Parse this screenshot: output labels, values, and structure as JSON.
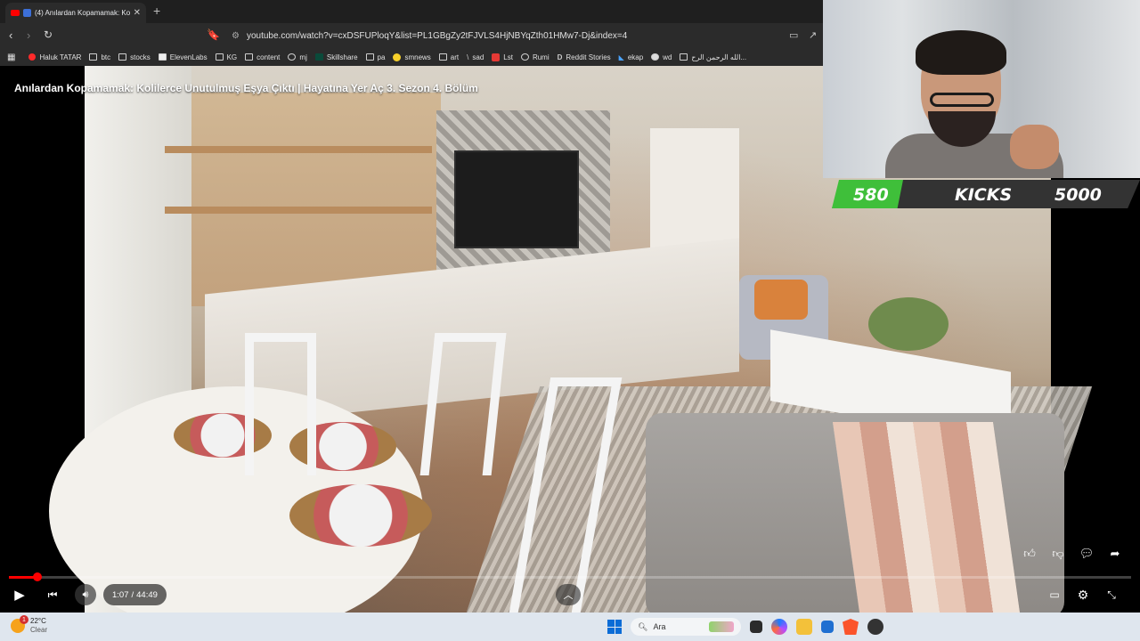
{
  "browser": {
    "tab_title": "(4) Anılardan Kopamamak: Ko",
    "url": "youtube.com/watch?v=cxDSFUPloqY&list=PL1GBgZy2tFJVLS4HjNBYqZth01HMw7-Dj&index=4",
    "bookmarks": [
      "Haluk TATAR",
      "btc",
      "stocks",
      "ElevenLabs",
      "KG",
      "content",
      "mj",
      "Skillshare",
      "pa",
      "smnews",
      "art",
      "sad",
      "Lst",
      "Rumi",
      "Reddit Stories",
      "ekap",
      "wd",
      "الله الرحمن الرح..."
    ]
  },
  "video": {
    "title": "Anılardan Kopamamak: Kolilerce Unutulmuş Eşya Çıktı | Hayatına Yer Aç 3. Sezon 4. Bölüm",
    "current_time": "1:07",
    "separator": "/",
    "duration": "44:49",
    "progress_fraction": 0.025
  },
  "kicks": {
    "count": "580",
    "label": "KICKS",
    "goal": "5000"
  },
  "taskbar": {
    "temperature": "22°C",
    "condition": "Clear",
    "notification_count": "1",
    "search_placeholder": "Ara"
  },
  "colors": {
    "accent_red": "#ff0000",
    "kicks_green": "#3fbf3a",
    "windows_blue": "#0b6cd6"
  }
}
